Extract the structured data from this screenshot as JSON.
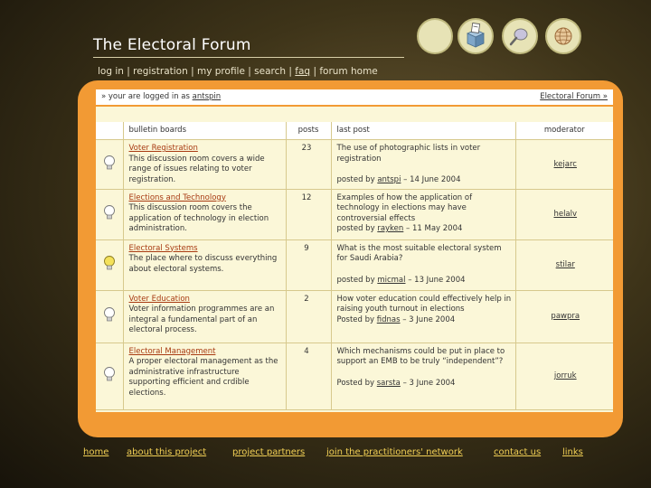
{
  "site": {
    "title": "The Electoral Forum"
  },
  "nav": {
    "items": [
      {
        "label": "log in",
        "underline": false
      },
      {
        "label": "registration",
        "underline": false
      },
      {
        "label": "my profile",
        "underline": false
      },
      {
        "label": "search",
        "underline": false
      },
      {
        "label": "faq",
        "underline": true
      },
      {
        "label": "forum home",
        "underline": false
      }
    ],
    "separator": "|"
  },
  "userbar": {
    "prefix": "» your are logged in as",
    "username": "antspin",
    "breadcrumb": "Electoral Forum »"
  },
  "table": {
    "headers": {
      "boards": "bulletin boards",
      "posts": "posts",
      "last_post": "last post",
      "moderator": "moderator"
    },
    "rows": [
      {
        "title": "Voter Registration",
        "description": "This discussion room covers a wide range of issues relating to voter registration.",
        "posts": "23",
        "last_post": "The use of photographic lists in voter registration",
        "posted_prefix": "posted by",
        "posted_user": "antspi",
        "posted_date": "– 14 June 2004",
        "moderator": "kejarc",
        "bulb": "off"
      },
      {
        "title": "Elections and Technology",
        "description": "This discussion room covers the application of technology in election administration.",
        "posts": "12",
        "last_post": "Examples of how the application of technology in elections may have controversial effects",
        "posted_prefix": "posted by",
        "posted_user": "rayken",
        "posted_date": "– 11 May 2004",
        "moderator": "helalv",
        "bulb": "off"
      },
      {
        "title": "Electoral Systems",
        "description": "The place where to discuss everything about electoral systems.",
        "posts": "9",
        "last_post": "What is the most suitable electoral system for Saudi Arabia?",
        "posted_prefix": "posted by",
        "posted_user": "micmal",
        "posted_date": "– 13 June 2004",
        "moderator": "stilar",
        "bulb": "on"
      },
      {
        "title": "Voter Education",
        "description": "Voter information programmes are an integral a fundamental part of an electoral process.",
        "posts": "2",
        "last_post": "How voter education could effectively help in raising youth turnout in elections",
        "posted_prefix": "Posted by",
        "posted_user": "fidnas",
        "posted_date": "– 3 June 2004",
        "moderator": "pawpra",
        "bulb": "off"
      },
      {
        "title": "Electoral Management",
        "description": "A proper electoral management as the administrative infrastructure supporting efficient and crdible elections.",
        "posts": "4",
        "last_post": "Which mechanisms could be put in place to support an EMB to be truly “independent”?",
        "posted_prefix": "Posted by",
        "posted_user": "sarsta",
        "posted_date": "– 3 June 2004",
        "moderator": "jorruk",
        "bulb": "off"
      }
    ]
  },
  "footer": {
    "links": [
      "home",
      "about this project",
      "project partners",
      "join the practitioners' network",
      "contact us",
      "links"
    ]
  },
  "colors": {
    "panel": "#f29a34",
    "board_title": "#a83a12",
    "footer_link": "#f1cf55"
  },
  "icons": [
    "blank-circle-icon",
    "ballot-box-icon",
    "search-magnifier-icon",
    "globe-icon",
    "light-bulb-icon"
  ]
}
